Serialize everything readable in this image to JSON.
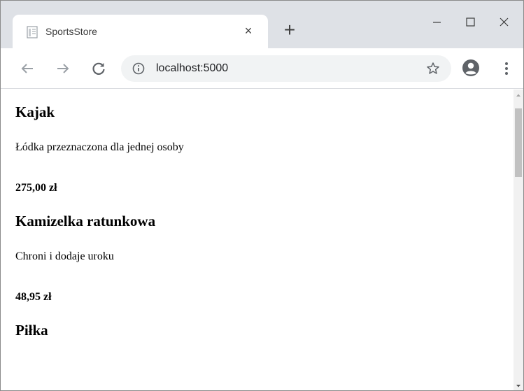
{
  "browser": {
    "tab": {
      "title": "SportsStore",
      "favicon": "page-icon",
      "close_glyph": "×"
    },
    "new_tab_glyph": "+",
    "window_controls": {
      "minimize": "minimize-icon",
      "maximize": "maximize-icon",
      "close": "close-icon"
    },
    "toolbar": {
      "back": "back-arrow-icon",
      "forward": "forward-arrow-icon",
      "reload": "reload-icon",
      "url": "localhost:5000",
      "info": "info-icon",
      "bookmark": "star-icon",
      "profile": "profile-icon",
      "menu": "kebab-menu-icon"
    }
  },
  "colors": {
    "tabstrip": "#dee1e6",
    "omnibox": "#f1f3f4",
    "scroll_thumb": "#c1c1c1"
  },
  "products": [
    {
      "name": "Kajak",
      "description": "Łódka przeznaczona dla jednej osoby",
      "price": "275,00 zł"
    },
    {
      "name": "Kamizelka ratunkowa",
      "description": "Chroni i dodaje uroku",
      "price": "48,95 zł"
    },
    {
      "name": "Piłka",
      "description": "",
      "price": ""
    }
  ]
}
